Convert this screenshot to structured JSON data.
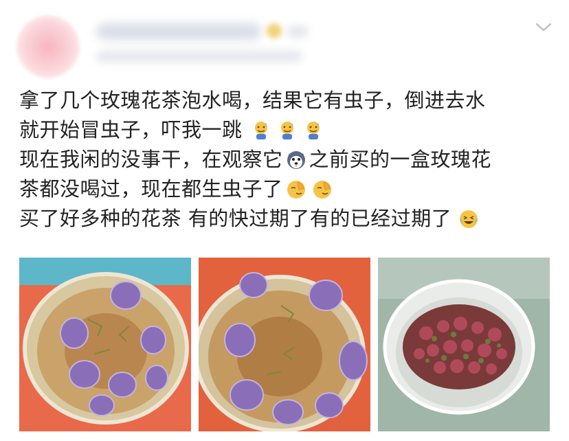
{
  "post": {
    "lines": [
      "拿了几个玫瑰花茶泡水喝，结果它有虫子，倒进去水",
      "就开始冒虫子，吓我一跳",
      "现在我闲的没事干，在观察它",
      "之前买的一盒玫瑰花",
      "茶都没喝过，现在都生虫子了",
      "买了好多种的花茶  有的快过期了有的已经过期了"
    ]
  },
  "header": {
    "menu_icon": "chevron-down-icon"
  },
  "emojis": [
    "awkward-sweat-emoji",
    "awkward-sweat-emoji",
    "awkward-sweat-emoji",
    "husky-face-emoji",
    "facepalm-emoji",
    "facepalm-emoji",
    "laugh-cry-emoji"
  ],
  "photos": [
    {
      "name": "rose-tea-cup-1"
    },
    {
      "name": "rose-tea-cup-2"
    },
    {
      "name": "dried-rose-buds-jar"
    }
  ],
  "colors": {
    "text": "#222222",
    "chevron": "#bbbbbb"
  }
}
